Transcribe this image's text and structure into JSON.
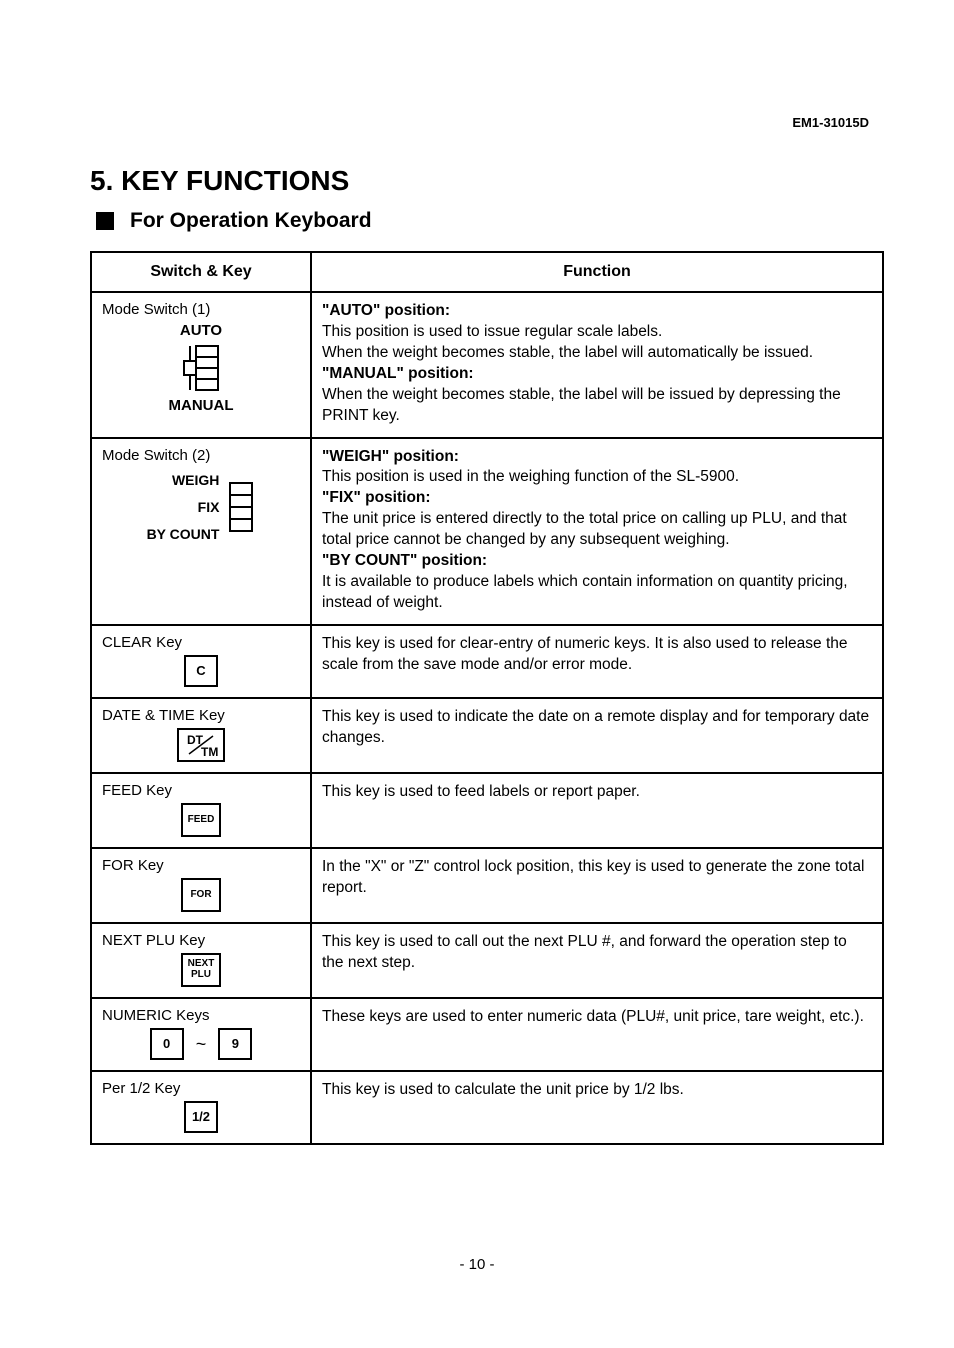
{
  "doc_id": "EM1-31015D",
  "title": "5. KEY  FUNCTIONS",
  "subtitle": "For Operation Keyboard",
  "page_number": "- 10 -",
  "headers": {
    "col1": "Switch & Key",
    "col2": "Function"
  },
  "rows": [
    {
      "key_name": "Mode Switch (1)",
      "labels": {
        "top": "AUTO",
        "bottom": "MANUAL"
      },
      "func": {
        "b1": "\"AUTO\" position:",
        "t1": "This position is used to issue regular scale labels.",
        "t2": "When the weight becomes stable, the label will automatically be issued.",
        "b2": "\"MANUAL\" position:",
        "t3": "When the weight becomes stable, the label will be issued by depressing the PRINT key."
      }
    },
    {
      "key_name": "Mode Switch (2)",
      "labels": {
        "top": "WEIGH",
        "mid": "FIX",
        "bottom": "BY COUNT"
      },
      "func": {
        "b1": "\"WEIGH\" position:",
        "t1": "This position is used in the weighing function of the SL-5900.",
        "b2": "\"FIX\" position:",
        "t2": "The unit price is entered directly to the total price on calling up PLU, and that total price cannot be changed by any subsequent weighing.",
        "b3": "\"BY COUNT\" position:",
        "t3": "It is available to produce labels which contain information on quantity pricing, instead of weight."
      }
    },
    {
      "key_name": "CLEAR Key",
      "key_label": "C",
      "func_text": "This key is used for clear-entry of numeric keys.   It is also used to release the scale from the save mode and/or error mode."
    },
    {
      "key_name": "DATE & TIME Key",
      "key_label": "DT/ TM",
      "func_text": "This key is used to indicate the date on a remote display and for temporary date changes."
    },
    {
      "key_name": "FEED Key",
      "key_label": "FEED",
      "func_text": "This key is used to feed labels or report paper."
    },
    {
      "key_name": "FOR Key",
      "key_label": "FOR",
      "func_text": "In the \"X\" or \"Z\" control lock position, this key is used to generate the zone total report."
    },
    {
      "key_name": "NEXT PLU Key",
      "key_label_l1": "NEXT",
      "key_label_l2": "PLU",
      "func_text": "This key is used to call out the next PLU #, and forward the operation step to the next step."
    },
    {
      "key_name": "NUMERIC Keys",
      "key_label_a": "0",
      "key_label_b": "9",
      "tilde": "~",
      "func_text": "These keys are used to enter numeric data (PLU#, unit price, tare weight, etc.)."
    },
    {
      "key_name": "Per 1/2 Key",
      "key_label": "1/2",
      "func_text": "This key is used to calculate the unit price by 1/2 lbs."
    }
  ]
}
